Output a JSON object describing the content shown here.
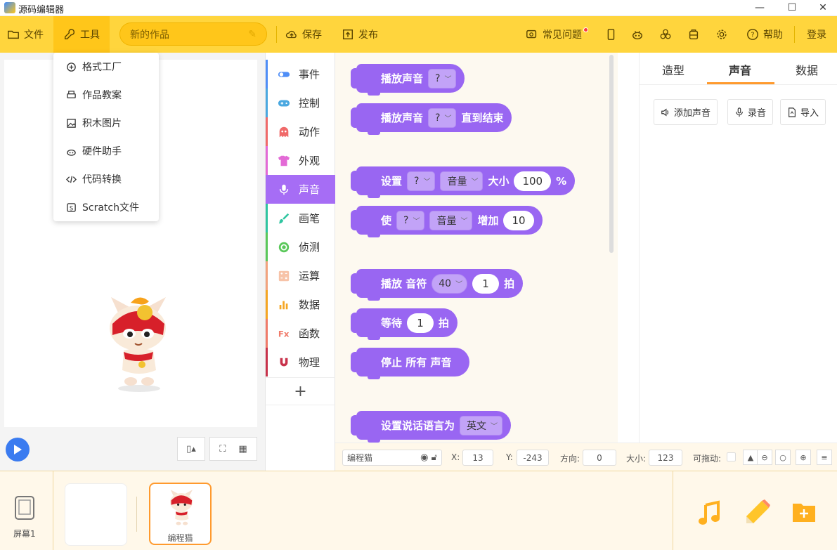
{
  "window": {
    "title": "源码编辑器",
    "controls": [
      "minimize",
      "maximize",
      "close"
    ]
  },
  "toolbar": {
    "file": "文件",
    "tools": "工具",
    "project_name": "新的作品",
    "save": "保存",
    "publish": "发布",
    "faq": "常见问题",
    "help": "帮助",
    "login": "登录"
  },
  "tools_menu": [
    {
      "label": "格式工厂",
      "icon": "format-factory-icon"
    },
    {
      "label": "作品教案",
      "icon": "print-icon"
    },
    {
      "label": "积木图片",
      "icon": "image-icon"
    },
    {
      "label": "硬件助手",
      "icon": "hardware-icon"
    },
    {
      "label": "代码转换",
      "icon": "code-icon"
    },
    {
      "label": "Scratch文件",
      "icon": "scratch-icon"
    }
  ],
  "categories": [
    {
      "label": "事件",
      "color": "#4f8ef7",
      "active": false
    },
    {
      "label": "控制",
      "color": "#4aa8e0",
      "active": false
    },
    {
      "label": "动作",
      "color": "#f06a6a",
      "active": false
    },
    {
      "label": "外观",
      "color": "#e36ad6",
      "active": false
    },
    {
      "label": "声音",
      "color": "#a66df5",
      "active": true
    },
    {
      "label": "画笔",
      "color": "#2fc5a0",
      "active": false
    },
    {
      "label": "侦测",
      "color": "#5ac85a",
      "active": false
    },
    {
      "label": "运算",
      "color": "#f2a37f",
      "active": false
    },
    {
      "label": "数据",
      "color": "#f5a623",
      "active": false
    },
    {
      "label": "函数",
      "color": "#f07b6a",
      "active": false
    },
    {
      "label": "物理",
      "color": "#c8324b",
      "active": false
    }
  ],
  "blocks": {
    "b1": {
      "t1": "播放声音",
      "dd": "?"
    },
    "b2": {
      "t1": "播放声音",
      "dd": "?",
      "t2": "直到结束"
    },
    "b3": {
      "t1": "设置",
      "dd1": "?",
      "dd2": "音量",
      "t2": "大小",
      "val": "100",
      "t3": "%"
    },
    "b4": {
      "t1": "使",
      "dd1": "?",
      "dd2": "音量",
      "t2": "增加",
      "val": "10"
    },
    "b5": {
      "t1": "播放 音符",
      "dd": "40",
      "val": "1",
      "t2": "拍"
    },
    "b6": {
      "t1": "等待",
      "val": "1",
      "t2": "拍"
    },
    "b7": {
      "t1": "停止 所有 声音"
    },
    "b8": {
      "t1": "设置说话语言为",
      "dd": "英文"
    }
  },
  "props": {
    "sprite_name": "编程猫",
    "x_label": "X:",
    "x": "13",
    "y_label": "Y:",
    "y": "-243",
    "dir_label": "方向:",
    "dir": "0",
    "size_label": "大小:",
    "size": "123",
    "drag_label": "可拖动:"
  },
  "right_panel": {
    "tabs": [
      "造型",
      "声音",
      "数据"
    ],
    "active_tab": "声音",
    "buttons": [
      "添加声音",
      "录音",
      "导入"
    ]
  },
  "bottom": {
    "screen_label": "屏幕1",
    "sprite_label": "编程猫"
  },
  "colors": {
    "accent": "#ffd53d",
    "sound": "#9966f2",
    "play": "#3a7bf0"
  }
}
